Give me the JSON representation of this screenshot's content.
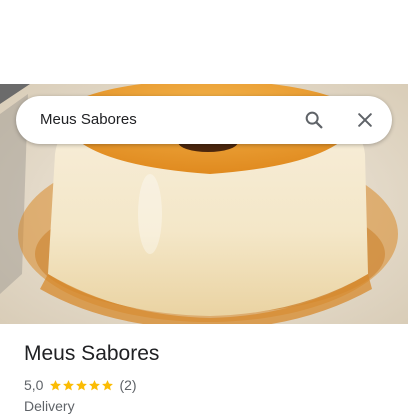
{
  "search": {
    "query": "Meus Sabores"
  },
  "icons": {
    "search": "search-icon",
    "close": "close-icon",
    "star": "star-icon"
  },
  "place": {
    "name": "Meus Sabores",
    "rating": "5,0",
    "rating_value": 5.0,
    "stars_filled": 5,
    "review_count": "(2)",
    "category": "Delivery"
  },
  "colors": {
    "star": "#fbbc04",
    "caramel": "#e8962a",
    "text_primary": "#202124",
    "text_secondary": "#5f6368",
    "icon": "#5f6368"
  }
}
